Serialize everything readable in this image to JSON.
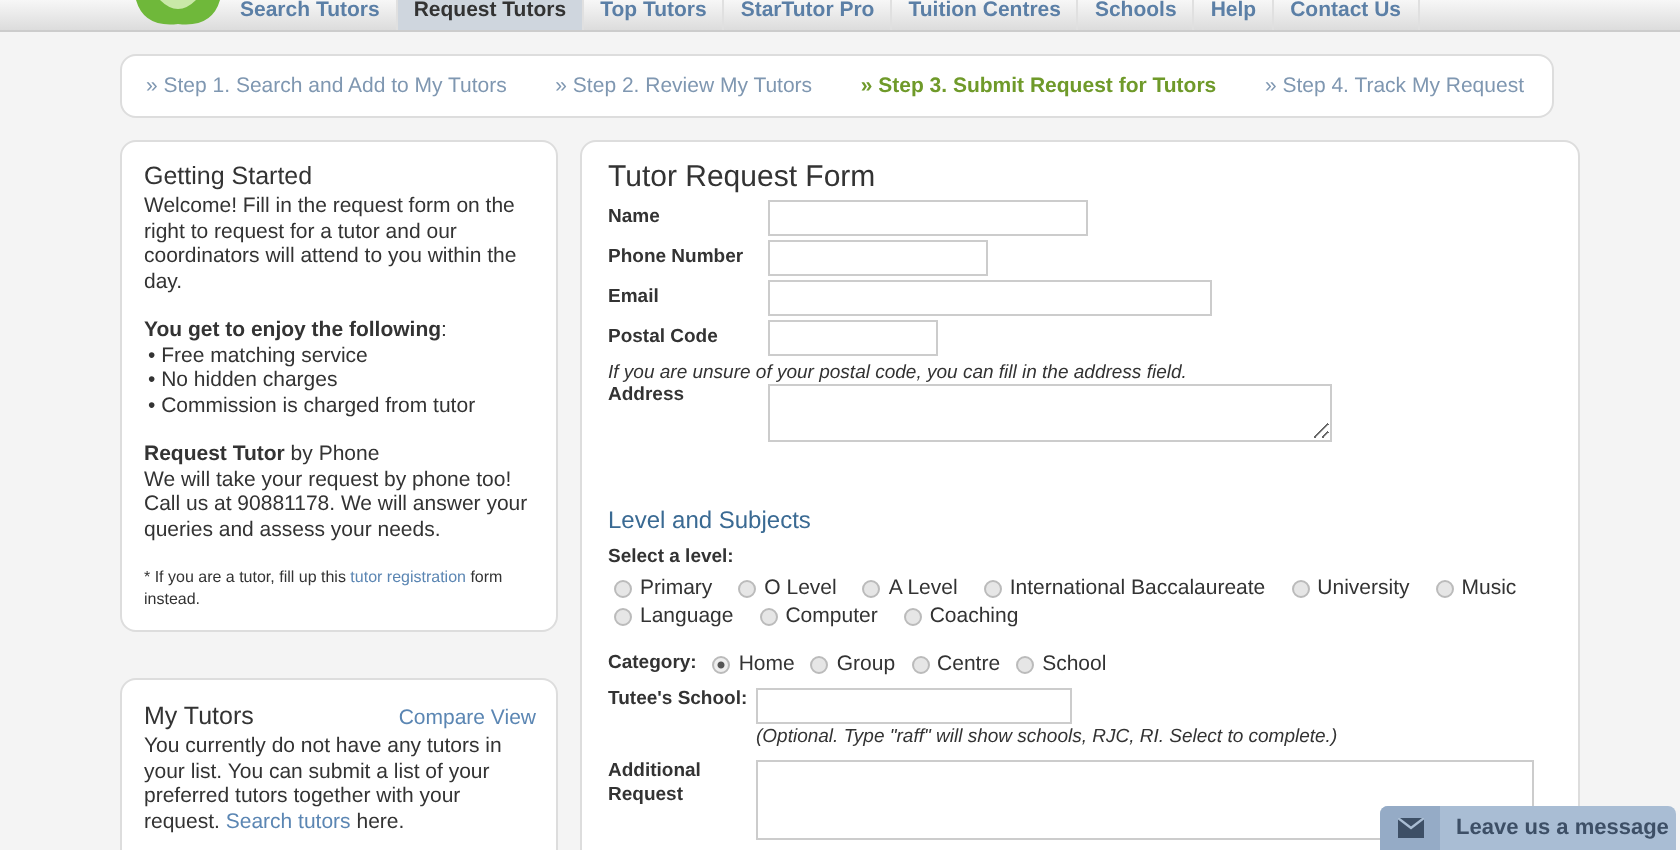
{
  "nav": [
    {
      "label": "Search Tutors",
      "selected": false
    },
    {
      "label": "Request Tutors",
      "selected": true
    },
    {
      "label": "Top Tutors",
      "selected": false
    },
    {
      "label": "StarTutor Pro",
      "selected": false
    },
    {
      "label": "Tuition Centres",
      "selected": false
    },
    {
      "label": "Schools",
      "selected": false
    },
    {
      "label": "Help",
      "selected": false
    },
    {
      "label": "Contact Us",
      "selected": false
    }
  ],
  "steps": [
    {
      "label": "» Step 1. Search and Add to My Tutors",
      "selected": false
    },
    {
      "label": "» Step 2. Review My Tutors",
      "selected": false
    },
    {
      "label": "» Step 3. Submit Request for Tutors",
      "selected": true
    },
    {
      "label": "» Step 4. Track My Request",
      "selected": false
    }
  ],
  "getting_started": {
    "title": "Getting Started",
    "intro": "Welcome! Fill in the request form on the right to request for a tutor and our coordinators will attend to you within the day.",
    "benefits_heading": "**You get to enjoy the following**:",
    "benefits": [
      "• Free matching service",
      "• No hidden charges",
      "• Commission is charged from tutor"
    ],
    "phone_heading": "**Request Tutor** by Phone",
    "phone_text": "We will take your request by phone too! Call us at 90881178. We will answer your queries and assess your needs.",
    "tutor_note_before": "* If you are a tutor, fill up this",
    "tutor_note_link": "tutor registration",
    "tutor_note_after": "form instead."
  },
  "my_tutors": {
    "title": "My Tutors",
    "compare_link": "Compare View",
    "text_before": "You currently do not have any tutors in your list. You can submit a list of your preferred tutors together with your request.",
    "search_link": "Search tutors",
    "text_after": "here."
  },
  "form": {
    "title": "Tutor Request Form",
    "fields": [
      {
        "label": "Name"
      },
      {
        "label": "Phone Number"
      },
      {
        "label": "Email"
      },
      {
        "label": "Postal Code"
      }
    ],
    "postal_hint": "If you are unsure of your postal code, you can fill in the address field.",
    "address_label": "Address",
    "section_title": "Level and Subjects",
    "level_label": "Select a level:",
    "levels": [
      {
        "label": "Primary",
        "selected": false
      },
      {
        "label": "O Level",
        "selected": false
      },
      {
        "label": "A Level",
        "selected": false
      },
      {
        "label": "International Baccalaureate",
        "selected": false
      },
      {
        "label": "University",
        "selected": false
      },
      {
        "label": "Music",
        "selected": false
      },
      {
        "label": "Language",
        "selected": false
      },
      {
        "label": "Computer",
        "selected": false
      },
      {
        "label": "Coaching",
        "selected": false
      }
    ],
    "category_label": "Category:",
    "categories": [
      {
        "label": "Home",
        "selected": true
      },
      {
        "label": "Group",
        "selected": false
      },
      {
        "label": "Centre",
        "selected": false
      },
      {
        "label": "School",
        "selected": false
      }
    ],
    "school_label": "Tutee's School:",
    "school_hint": "(Optional. Type \"raff\" will show schools, RJC, RI. Select to complete.)",
    "additional_label": "Additional Request"
  },
  "message_button": "Leave us a message"
}
